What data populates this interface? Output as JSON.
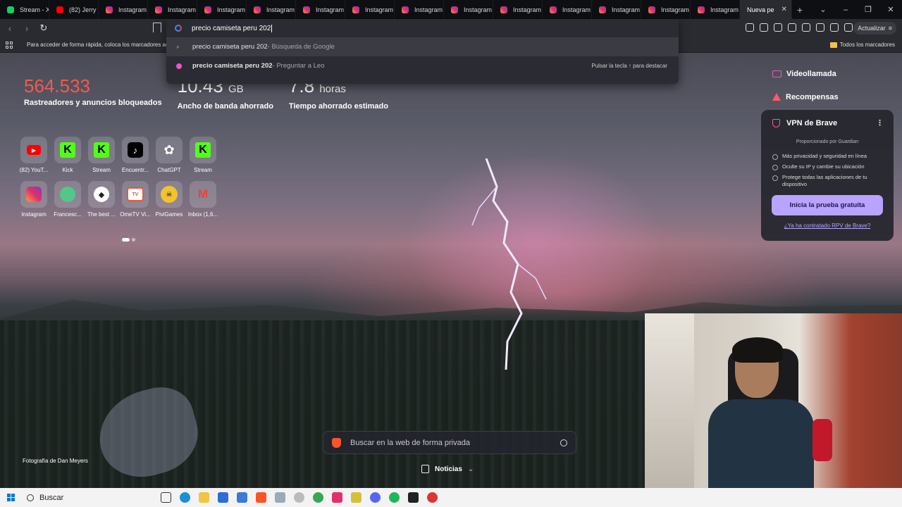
{
  "tabs": [
    {
      "label": "Stream - X",
      "favicon": "kick-icon"
    },
    {
      "label": "(82) Jerry",
      "favicon": "youtube-icon"
    },
    {
      "label": "Instagram",
      "favicon": "instagram-icon"
    },
    {
      "label": "Instagram",
      "favicon": "instagram-icon"
    },
    {
      "label": "Instagram",
      "favicon": "instagram-icon"
    },
    {
      "label": "Instagram",
      "favicon": "instagram-icon"
    },
    {
      "label": "Instagram",
      "favicon": "instagram-icon"
    },
    {
      "label": "Instagram",
      "favicon": "instagram-icon"
    },
    {
      "label": "Instagram",
      "favicon": "instagram-icon"
    },
    {
      "label": "Instagram",
      "favicon": "instagram-icon"
    },
    {
      "label": "Instagram",
      "favicon": "instagram-icon"
    },
    {
      "label": "Instagram",
      "favicon": "instagram-icon"
    },
    {
      "label": "Instagram",
      "favicon": "instagram-icon"
    },
    {
      "label": "Instagram",
      "favicon": "instagram-icon"
    },
    {
      "label": "Instagram",
      "favicon": "instagram-icon"
    }
  ],
  "active_tab": {
    "label": "Nueva pe"
  },
  "toolbar": {
    "update_label": "Actualizar"
  },
  "omnibox": {
    "query": "precio camiseta peru 202",
    "suggestions": [
      {
        "strong": "",
        "text": "precio camiseta peru 202",
        "suffix": " - Búsqueda de Google"
      },
      {
        "strong": "precio camiseta peru 202",
        "text": "",
        "suffix": " - Preguntar a Leo"
      }
    ],
    "hint": "Pulsar la tecla ↑ para destacar"
  },
  "bookmarks": {
    "prompt": "Para acceder de forma rápida, coloca los marcadores aq",
    "all_label": "Todos los marcadores"
  },
  "stats": [
    {
      "value": "564.533",
      "unit": "",
      "label": "Rastreadores y anuncios bloqueados",
      "color": "#f25a4d"
    },
    {
      "value": "10.43",
      "unit": "GB",
      "label": "Ancho de banda ahorrado",
      "color": "#ffffff"
    },
    {
      "value": "7.8",
      "unit": "horas",
      "label": "Tiempo ahorrado estimado",
      "color": "#ffffff"
    }
  ],
  "top_sites": [
    {
      "name": "(82) YouT...",
      "icon": "youtube-icon"
    },
    {
      "name": "Kick",
      "icon": "kick-icon"
    },
    {
      "name": "Stream",
      "icon": "kick-icon"
    },
    {
      "name": "Encuentr...",
      "icon": "tiktok-icon"
    },
    {
      "name": "ChatGPT",
      "icon": "chatgpt-icon"
    },
    {
      "name": "Stream",
      "icon": "kick-icon"
    },
    {
      "name": "Instagram",
      "icon": "instagram-icon"
    },
    {
      "name": "Francesc...",
      "icon": "green-circle-icon"
    },
    {
      "name": "The best ...",
      "icon": "chat-bubble-icon"
    },
    {
      "name": "OmeTV Vi...",
      "icon": "ometv-icon"
    },
    {
      "name": "PiviGames",
      "icon": "pivigames-icon"
    },
    {
      "name": "Inbox (1,6...",
      "icon": "gmail-icon"
    }
  ],
  "right_links": [
    {
      "label": "Videollamada",
      "icon": "video-call-icon"
    },
    {
      "label": "Recompensas",
      "icon": "rewards-triangle-icon"
    }
  ],
  "vpn": {
    "title": "VPN de Brave",
    "provided_by": "Proporcionado por  Guardian",
    "features": [
      "Más privacidad y seguridad en línea",
      "Oculte su IP y cambie su ubicación",
      "Protege todas las aplicaciones de tu dispositivo"
    ],
    "cta": "Inicia la prueba gratuita",
    "link": "¿Ya ha contratado RPV de Brave?"
  },
  "search": {
    "placeholder": "Buscar en la web de forma privada"
  },
  "news": {
    "label": "Noticias"
  },
  "photo_credit": "Fotografía de Dan Meyers",
  "taskbar": {
    "search_label": "Buscar"
  }
}
